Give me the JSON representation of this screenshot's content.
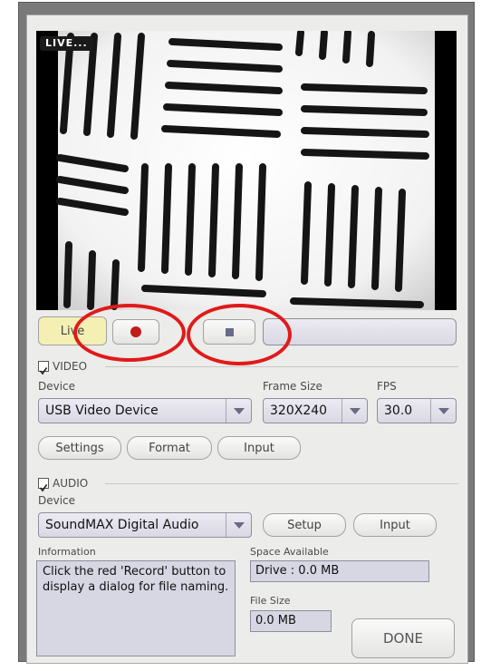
{
  "video_preview": {
    "badge": "LIVE..."
  },
  "transport": {
    "live_label": "Live",
    "status_text": ""
  },
  "video": {
    "section_label": "VIDEO",
    "checked": true,
    "device_label": "Device",
    "device_value": "USB Video Device",
    "frame_size_label": "Frame Size",
    "frame_size_value": "320X240",
    "fps_label": "FPS",
    "fps_value": "30.0",
    "settings_label": "Settings",
    "format_label": "Format",
    "input_label": "Input"
  },
  "audio": {
    "section_label": "AUDIO",
    "checked": true,
    "device_label": "Device",
    "device_value": "SoundMAX Digital Audio",
    "setup_label": "Setup",
    "input_label": "Input"
  },
  "info": {
    "label": "Information",
    "text": "Click the red 'Record' button to display a dialog for file naming."
  },
  "space": {
    "label": "Space Available",
    "value": "Drive : 0.0 MB"
  },
  "file_size": {
    "label": "File Size",
    "value": "0.0 MB"
  },
  "done_label": "DONE",
  "colors": {
    "record_red": "#c41a1a",
    "annotation_red": "#e01a1a",
    "live_bg": "#f4f0b4"
  }
}
